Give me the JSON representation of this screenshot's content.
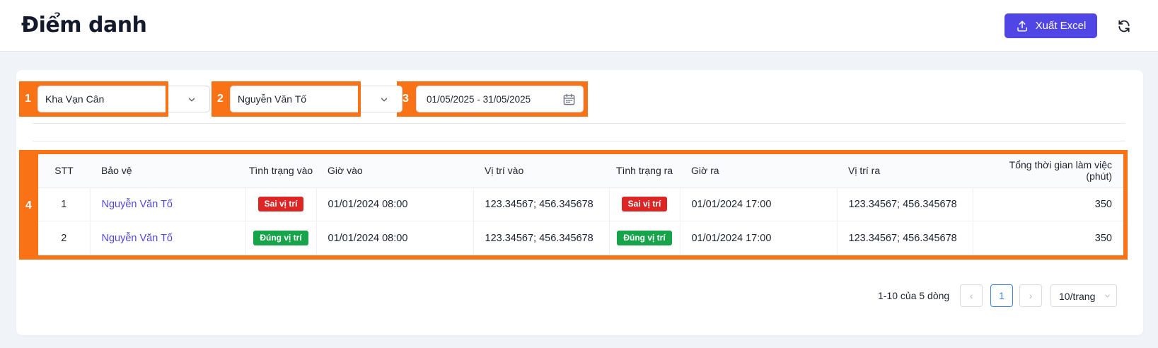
{
  "header": {
    "title": "Điểm danh",
    "export_label": "Xuất Excel"
  },
  "colors": {
    "accent": "#4f46e5",
    "marker": "#f97316",
    "badge_wrong": "#dc2626",
    "badge_right": "#16a34a"
  },
  "markers": [
    "1",
    "2",
    "3",
    "4"
  ],
  "filters": {
    "location": "Kha Vạn Cân",
    "guard": "Nguyễn Văn Tố",
    "date_range": "01/05/2025 - 31/05/2025"
  },
  "table": {
    "columns": [
      "STT",
      "Bảo vệ",
      "Tình trạng vào",
      "Giờ vào",
      "Vị trí vào",
      "Tình trạng ra",
      "Giờ ra",
      "Vị trí ra",
      "Tổng thời gian làm việc (phút)"
    ],
    "rows": [
      {
        "stt": "1",
        "guard": "Nguyễn Văn Tố",
        "status_in": "Sai vị trí",
        "time_in": "01/01/2024 08:00",
        "pos_in": "123.34567; 456.345678",
        "status_out": "Sai vị trí",
        "time_out": "01/01/2024 17:00",
        "pos_out": "123.34567; 456.345678",
        "total": "350"
      },
      {
        "stt": "2",
        "guard": "Nguyễn Văn Tố",
        "status_in": "Đúng vị trí",
        "time_in": "01/01/2024 08:00",
        "pos_in": "123.34567; 456.345678",
        "status_out": "Đúng vị trí",
        "time_out": "01/01/2024 17:00",
        "pos_out": "123.34567; 456.345678",
        "total": "350"
      }
    ]
  },
  "pagination": {
    "info": "1-10 của 5 dòng",
    "prev": "‹",
    "current_page": "1",
    "next": "›",
    "page_size": "10/trang"
  }
}
